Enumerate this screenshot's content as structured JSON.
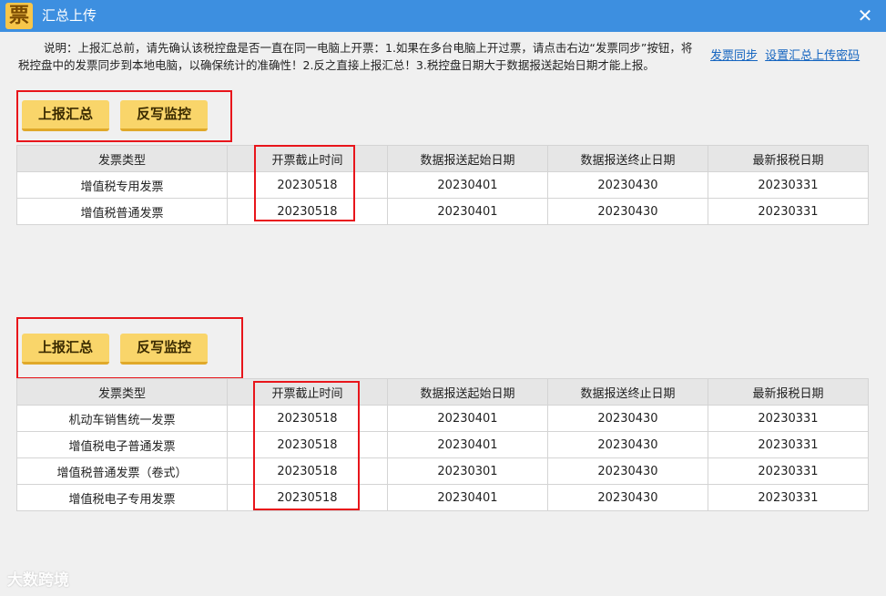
{
  "window": {
    "icon_glyph": "票",
    "title": "汇总上传",
    "close_glyph": "✕"
  },
  "description": "说明：上报汇总前，请先确认该税控盘是否一直在同一电脑上开票：1.如果在多台电脑上开过票，请点击右边“发票同步”按钮，将税控盘中的发票同步到本地电脑，以确保统计的准确性！2.反之直接上报汇总！3.税控盘日期大于数据报送起始日期才能上报。",
  "links": {
    "sync": "发票同步",
    "password": "设置汇总上传密码"
  },
  "colors": {
    "titlebar": "#3d8fe0",
    "button": "#f9d56a",
    "highlight_box": "#e8151b",
    "link": "#1565c0"
  },
  "sections": [
    {
      "buttons": {
        "report": "上报汇总",
        "writeback": "反写监控"
      },
      "columns": [
        "发票类型",
        "开票截止时间",
        "数据报送起始日期",
        "数据报送终止日期",
        "最新报税日期"
      ],
      "rows": [
        [
          "增值税专用发票",
          "20230518",
          "20230401",
          "20230430",
          "20230331"
        ],
        [
          "增值税普通发票",
          "20230518",
          "20230401",
          "20230430",
          "20230331"
        ]
      ]
    },
    {
      "buttons": {
        "report": "上报汇总",
        "writeback": "反写监控"
      },
      "columns": [
        "发票类型",
        "开票截止时间",
        "数据报送起始日期",
        "数据报送终止日期",
        "最新报税日期"
      ],
      "rows": [
        [
          "机动车销售统一发票",
          "20230518",
          "20230401",
          "20230430",
          "20230331"
        ],
        [
          "增值税电子普通发票",
          "20230518",
          "20230401",
          "20230430",
          "20230331"
        ],
        [
          "增值税普通发票（卷式）",
          "20230518",
          "20230301",
          "20230430",
          "20230331"
        ],
        [
          "增值税电子专用发票",
          "20230518",
          "20230401",
          "20230430",
          "20230331"
        ]
      ]
    }
  ],
  "watermark": "大数跨境"
}
